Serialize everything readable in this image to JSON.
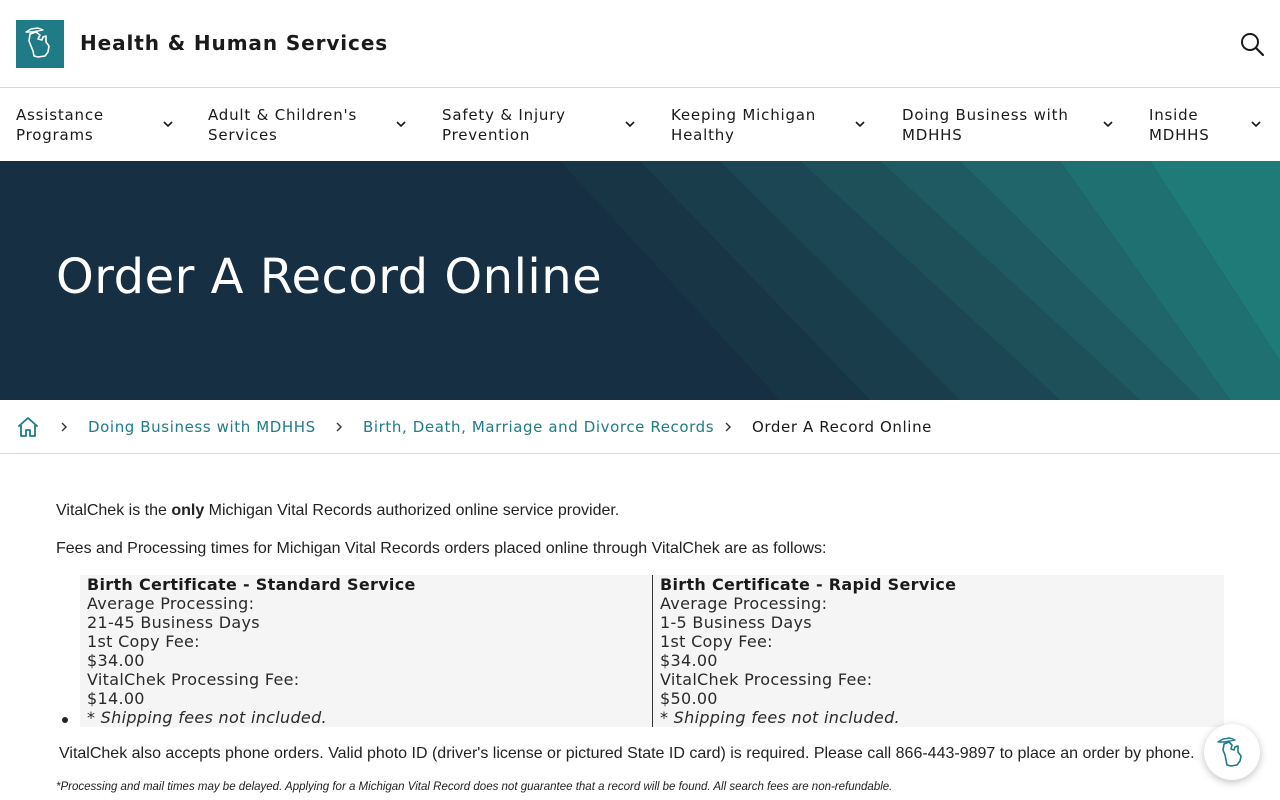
{
  "colors": {
    "brand_teal": "#1f7b86",
    "hero_dark": "#172f42",
    "link": "#1f7b86"
  },
  "header": {
    "logo_icon": "michigan-state-icon",
    "title": "Health & Human Services",
    "search_icon": "search-icon"
  },
  "nav": {
    "items": [
      {
        "label": "Assistance Programs",
        "icon": "chevron-down-icon"
      },
      {
        "label": "Adult & Children's Services",
        "icon": "chevron-down-icon"
      },
      {
        "label": "Safety & Injury Prevention",
        "icon": "chevron-down-icon"
      },
      {
        "label": "Keeping Michigan Healthy",
        "icon": "chevron-down-icon"
      },
      {
        "label": "Doing Business with MDHHS",
        "icon": "chevron-down-icon"
      },
      {
        "label": "Inside MDHHS",
        "icon": "chevron-down-icon"
      }
    ]
  },
  "hero": {
    "title": "Order A Record Online"
  },
  "breadcrumb": {
    "home_icon": "home-icon",
    "items": [
      {
        "label": "Doing Business with MDHHS"
      },
      {
        "label": "Birth, Death, Marriage and Divorce Records"
      },
      {
        "label": "Order A Record Online"
      }
    ]
  },
  "main": {
    "intro_before": "VitalChek is the ",
    "intro_bold": "only",
    "intro_after": " Michigan Vital Records authorized online service provider.",
    "fees_intro": "Fees and Processing times for Michigan Vital Records orders placed online through VitalChek are as follows:",
    "fee_table": {
      "standard": {
        "heading": "Birth Certificate - Standard Service",
        "processing_label": "Average Processing:",
        "processing_value": "21-45 Business Days",
        "copy_fee_label": "1st Copy Fee:",
        "copy_fee_value": "$34.00",
        "processing_fee_label": "VitalChek Processing Fee:",
        "processing_fee_value": "$14.00",
        "note": "* Shipping fees not included."
      },
      "rapid": {
        "heading": "Birth Certificate - Rapid Service",
        "processing_label": "Average Processing:",
        "processing_value": "1-5 Business Days",
        "copy_fee_label": "1st Copy Fee:",
        "copy_fee_value": "$34.00",
        "processing_fee_label": "VitalChek Processing Fee:",
        "processing_fee_value": "$50.00",
        "note": "* Shipping fees not included."
      }
    },
    "phone_orders": "VitalChek also accepts phone orders.  Valid photo ID (driver's license or pictured State ID card) is required.  Please call 866-443-9897 to place an order by phone.",
    "disclaimer": "*Processing and mail times may be delayed.  Applying for a Michigan Vital Record does not guarantee that a record will be found.  All search fees are non-refundable."
  },
  "chat": {
    "icon": "michigan-chat-icon"
  }
}
